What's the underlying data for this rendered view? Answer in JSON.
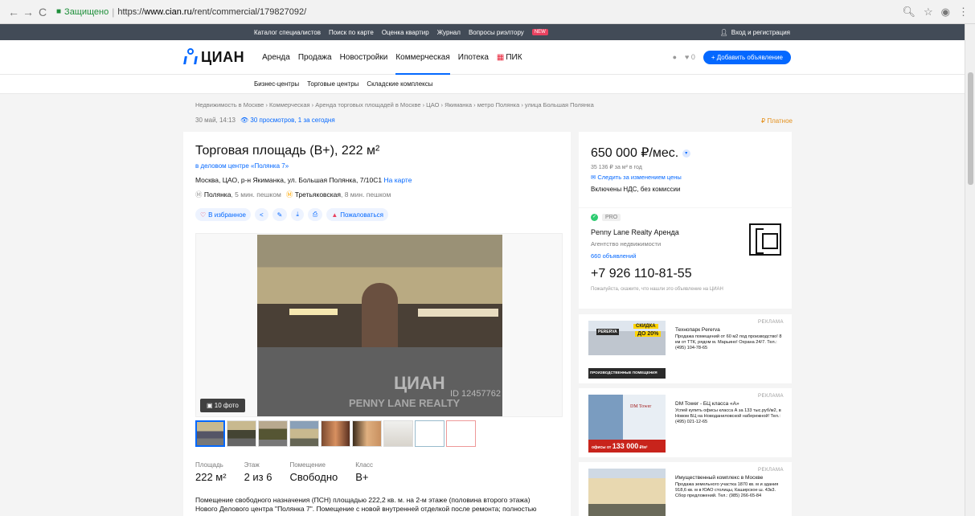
{
  "browser": {
    "secure_label": "Защищено",
    "url_scheme": "https://",
    "url_host": "www.cian.ru",
    "url_path": "/rent/commercial/179827092/"
  },
  "topbar": {
    "links": [
      "Каталог специалистов",
      "Поиск по карте",
      "Оценка квартир",
      "Журнал",
      "Вопросы риэлтору"
    ],
    "new_badge": "NEW",
    "login": "Вход и регистрация"
  },
  "header": {
    "logo": "ЦИАН",
    "nav": [
      "Аренда",
      "Продажа",
      "Новостройки",
      "Коммерческая",
      "Ипотека"
    ],
    "pik": "ПИК",
    "favorites_count": "0",
    "add_button": "+ Добавить объявление"
  },
  "subnav": [
    "Бизнес-центры",
    "Торговые центры",
    "Складские комплексы"
  ],
  "breadcrumbs": "Недвижимость в Москве  ›  Коммерческая  ›  Аренда торговых площадей в Москве  ›  ЦАО  ›  Якиманка  ›  метро Полянка  ›  улица Большая Полянка",
  "meta": {
    "date": "30 май, 14:13",
    "views": "30 просмотров, 1 за сегодня",
    "paid": "Платное"
  },
  "listing": {
    "title": "Торговая площадь (В+), 222 м²",
    "business_center": "в деловом центре «Полянка 7»",
    "address": "Москва, ЦАО, р-н Якиманка, ул. Большая Полянка, 7/10С1",
    "on_map": "На карте",
    "metro": [
      {
        "name": "Полянка",
        "time": "5 мин. пешком"
      },
      {
        "name": "Третьяковская",
        "time": "8 мин. пешком"
      }
    ],
    "actions": {
      "favorite": "В избранное",
      "complain": "Пожаловаться"
    },
    "photo_count": "10 фото",
    "watermark_logo": "ЦИАН",
    "watermark_agency": "PENNY LANE REALTY",
    "watermark_id": "ID 12457762",
    "facts": [
      {
        "label": "Площадь",
        "value": "222 м²"
      },
      {
        "label": "Этаж",
        "value": "2 из 6"
      },
      {
        "label": "Помещение",
        "value": "Свободно"
      },
      {
        "label": "Класс",
        "value": "B+"
      }
    ],
    "description_1": "Помещение свободного назначения (ПСН) площадью 222,2 кв. м. на 2-м этаже (половина второго этажа)",
    "description_2": "Нового Делового центра \"Полянка 7\". Помещение с новой внутренней отделкой после ремонта; полностью"
  },
  "price": {
    "value": "650 000 ₽/мес.",
    "per_sqm": "35 136 ₽ за м² в год",
    "follow": "Следить за изменением цены",
    "vat": "Включены НДС, без комиссии"
  },
  "agent": {
    "pro": "PRO",
    "name": "Penny Lane Realty Аренда",
    "type": "Агентство недвижимости",
    "listings": "660 объявлений",
    "phone": "+7 926 110-81-55",
    "note": "Пожалуйста, скажите, что нашли это объявление на ЦИАН"
  },
  "ads": [
    {
      "label": "РЕКЛАМА",
      "title": "Технопарк Pererva",
      "text": "Продажа помещений от 60 м2 под производство! 8 км от ТТК, рядом м. Марьино! Охрана 24/7. Тел.: (495) 104-78-65",
      "img_brand": "PERERVA",
      "img_promo_1": "СКИДКА",
      "img_promo_2": "ДО 20%",
      "img_caption": "ПРОИЗВОДСТВЕННЫЕ ПОМЕЩЕНИЯ"
    },
    {
      "label": "РЕКЛАМА",
      "title": "DM Tower - БЦ класса «А»",
      "text": "Успей купить офисы класса А за 133 тыс.руб/м2, в Новом БЦ на Новоданиловской набережной! Тел.: (495) 021-12-65",
      "img_brand": "DM Tower",
      "img_caption_1": "офисы от",
      "img_caption_2": "133 000",
      "img_caption_3": "₽/м²"
    },
    {
      "label": "РЕКЛАМА",
      "title": "Имущественный комплекс в Москве",
      "text": "Продажа земельного участка 1870 кв. м и здания 918,6 кв. м в ЮАО столицы, Каширское ш. 43к3. Сбор предложений. Тел.: (985) 266-65-84"
    }
  ],
  "colors": {
    "accent": "#0468ff",
    "topbar": "#424b57",
    "paid": "#e4901c",
    "metro_orange": "#ffa800"
  }
}
